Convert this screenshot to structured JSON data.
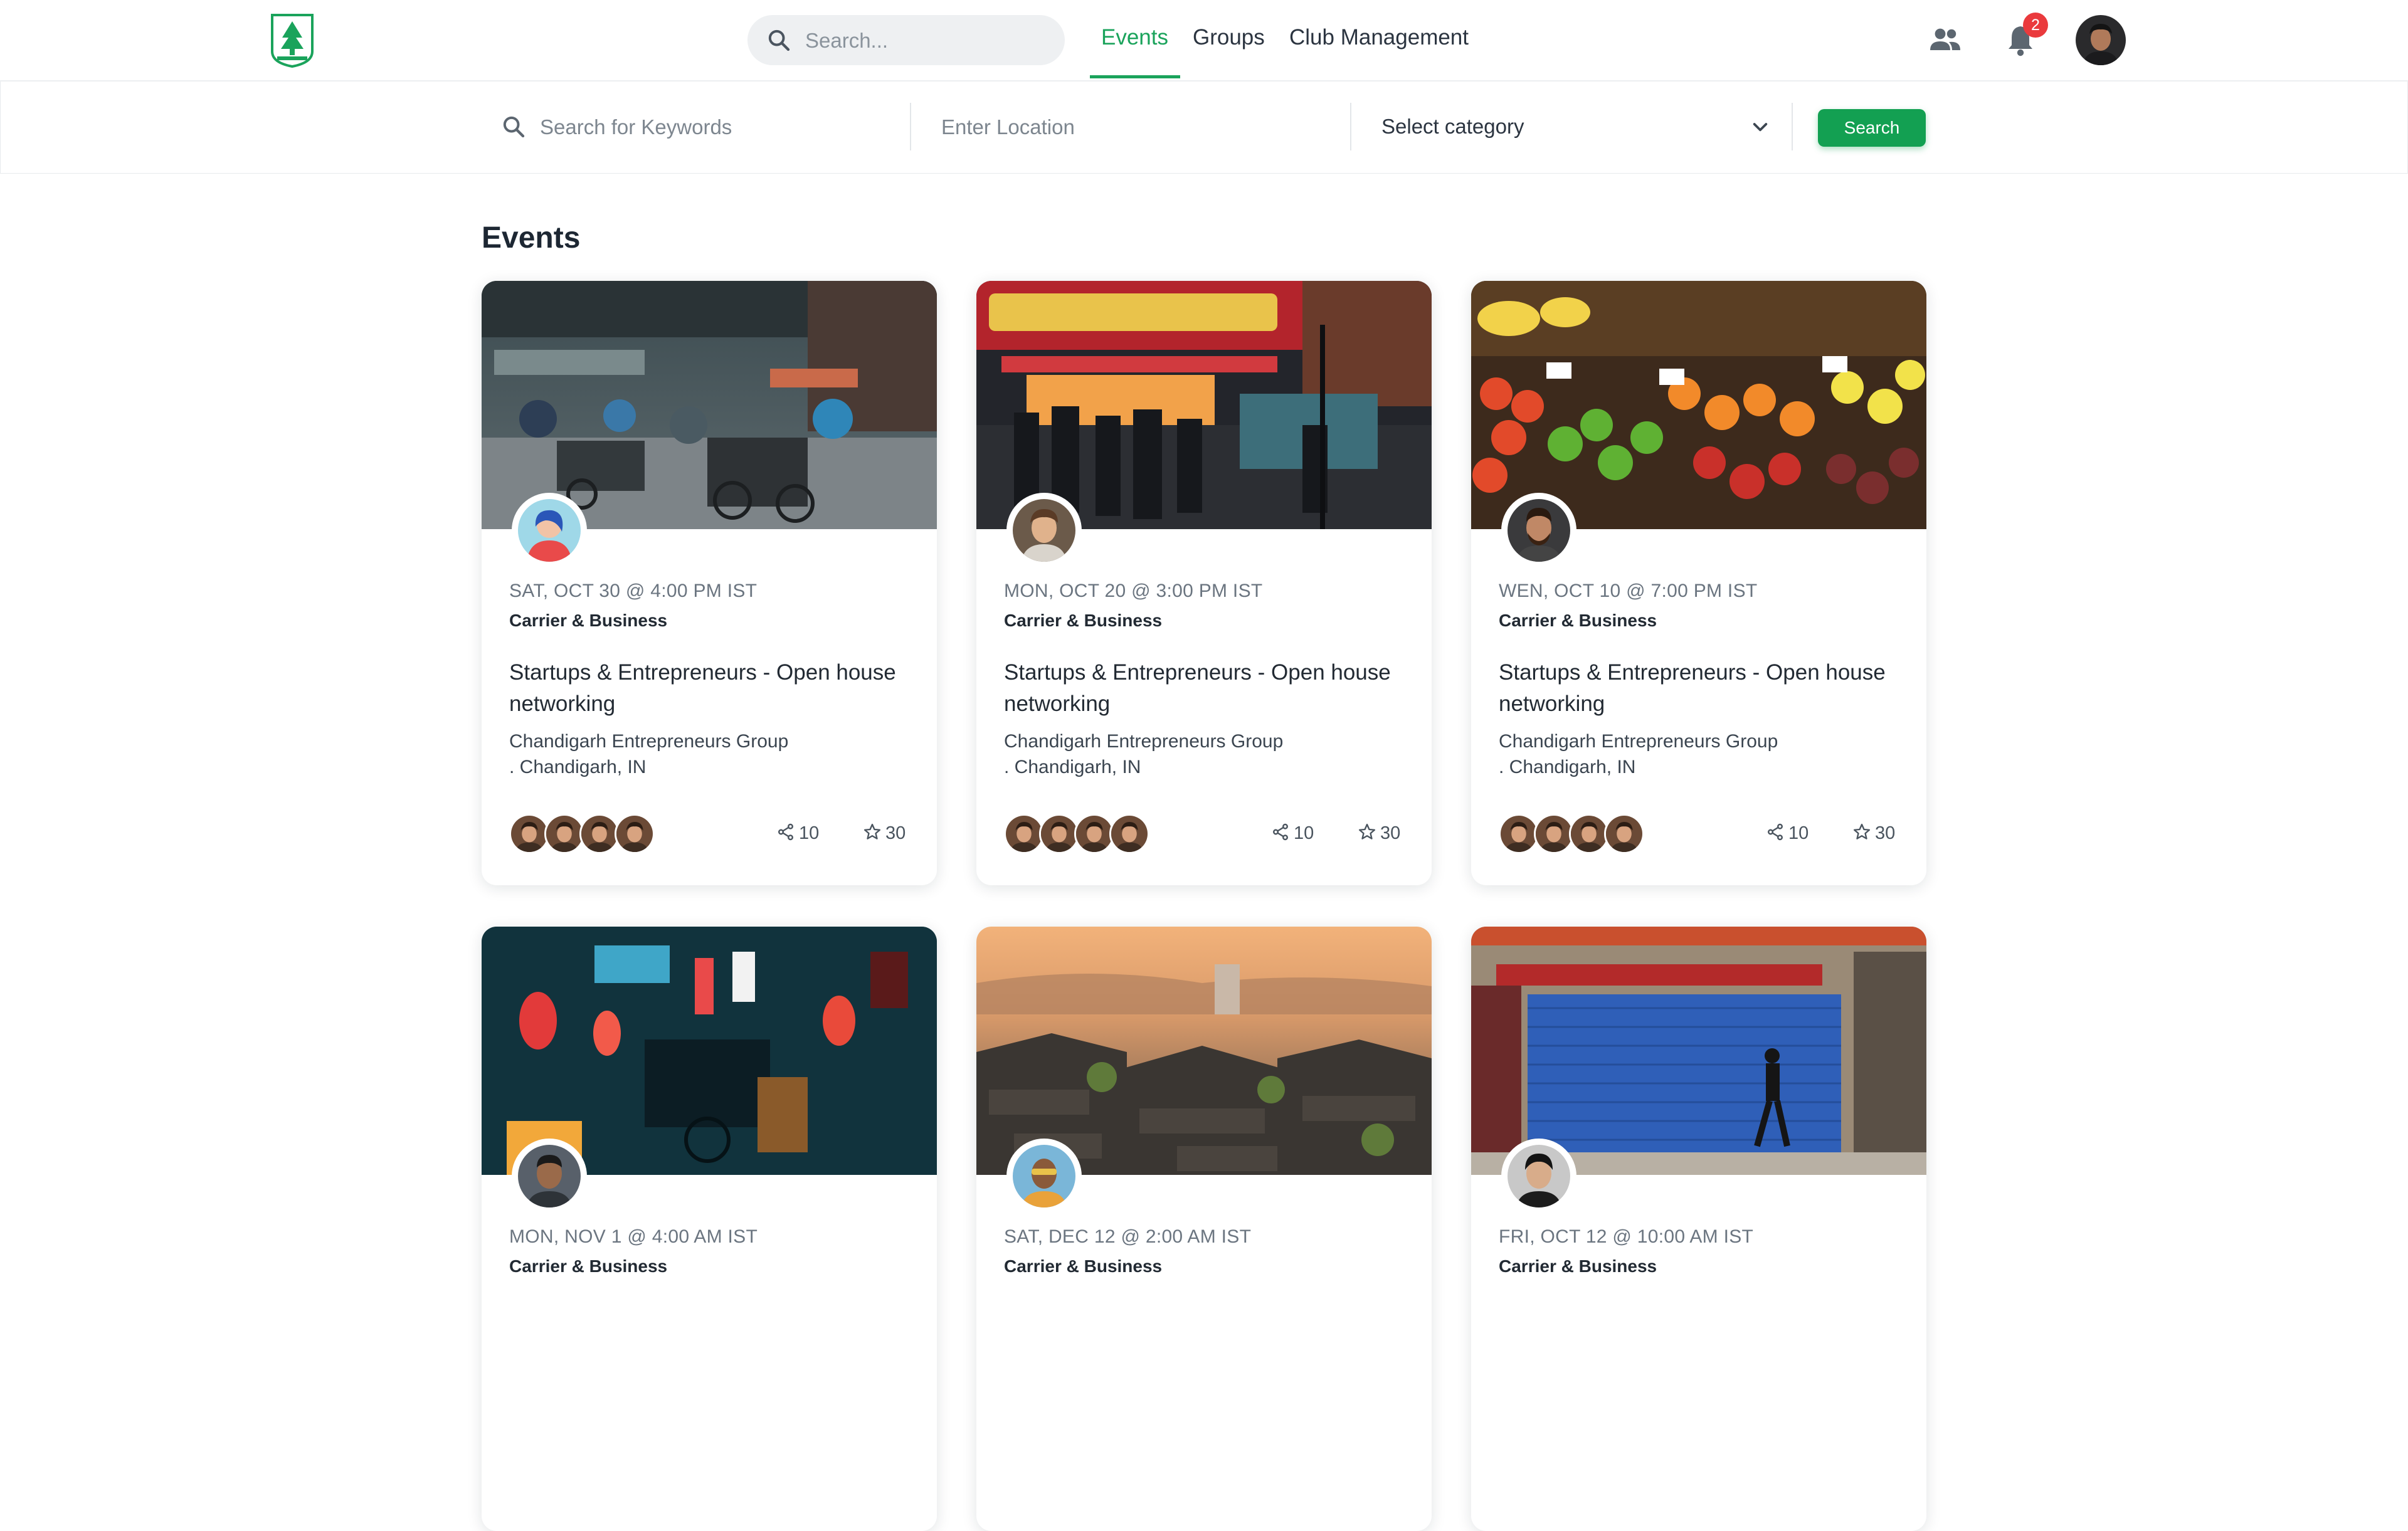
{
  "nav": {
    "search_placeholder": "Search...",
    "links": [
      "Events",
      "Groups",
      "Club Management"
    ],
    "notification_count": "2",
    "accent": "#1aa35b"
  },
  "filters": {
    "keyword_placeholder": "Search for Keywords",
    "location_placeholder": "Enter Location",
    "category_value": "Select category",
    "search_button": "Search"
  },
  "page_title": "Events",
  "cards": [
    {
      "date": "SAT, OCT 30 @ 4:00 PM IST",
      "category": "Carrier & Business",
      "title": "Startups & Entrepreneurs - Open house networking",
      "org_line1": "Chandigarh Entrepreneurs Group",
      "org_line2": ". Chandigarh, IN",
      "shares": "10",
      "stars": "30",
      "image": "street-market-rickshaws"
    },
    {
      "date": "MON, OCT 20 @ 3:00 PM IST",
      "category": "Carrier & Business",
      "title": "Startups & Entrepreneurs - Open house networking",
      "org_line1": "Chandigarh Entrepreneurs Group",
      "org_line2": ". Chandigarh, IN",
      "shares": "10",
      "stars": "30",
      "image": "delicatessen-night-crowd"
    },
    {
      "date": "WEN, OCT 10 @ 7:00 PM IST",
      "category": "Carrier & Business",
      "title": "Startups & Entrepreneurs - Open house networking",
      "org_line1": "Chandigarh Entrepreneurs Group",
      "org_line2": ". Chandigarh, IN",
      "shares": "10",
      "stars": "30",
      "image": "fruit-vegetable-stall"
    },
    {
      "date": "MON, NOV 1 @ 4:00 AM IST",
      "category": "Carrier & Business",
      "title": "",
      "org_line1": "",
      "org_line2": "",
      "shares": "",
      "stars": "",
      "image": "neon-alley-lanterns"
    },
    {
      "date": "SAT, DEC 12 @ 2:00 AM IST",
      "category": "Carrier & Business",
      "title": "",
      "org_line1": "",
      "org_line2": "",
      "shares": "",
      "stars": "",
      "image": "village-rooftops-sunset"
    },
    {
      "date": "FRI, OCT 12 @ 10:00 AM IST",
      "category": "Carrier & Business",
      "title": "",
      "org_line1": "",
      "org_line2": "",
      "shares": "",
      "stars": "",
      "image": "blue-shutter-storefront"
    }
  ]
}
